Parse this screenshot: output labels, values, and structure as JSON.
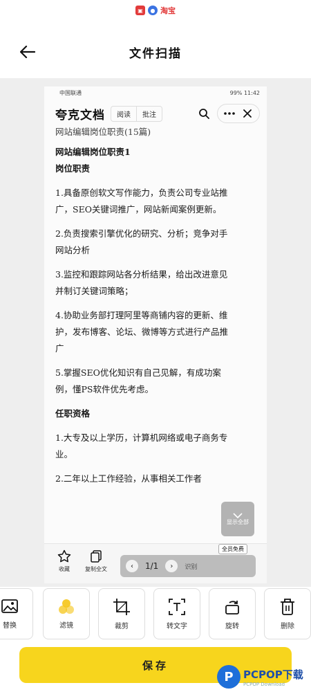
{
  "status_strip": {
    "badge_text": "淘宝"
  },
  "header": {
    "title": "文件扫描"
  },
  "document": {
    "phone_status": {
      "carrier": "中国联通",
      "battery": "99%",
      "time": "11:42"
    },
    "brand": "夸克文档",
    "tabs": [
      "阅读",
      "批注"
    ],
    "lines": [
      {
        "text": "网站编辑岗位职责(15篇)",
        "style": "cut"
      },
      {
        "text": "网站编辑岗位职责1",
        "style": "bold"
      },
      {
        "text": "岗位职责",
        "style": "bold"
      },
      {
        "text": "1.具备原创软文写作能力，负责公司专业站推",
        "style": "normal"
      },
      {
        "text": "广，SEO关键词推广，网站新闻案例更新。",
        "style": "normal"
      },
      {
        "text": "2.负责搜索引擎优化的研究、分析；竞争对手",
        "style": "normal"
      },
      {
        "text": "网站分析",
        "style": "normal"
      },
      {
        "text": "3.监控和跟踪网站各分析结果，给出改进意见",
        "style": "normal"
      },
      {
        "text": "并制订关键词策略；",
        "style": "normal"
      },
      {
        "text": "4.协助业务部打理阿里等商铺内容的更新、维",
        "style": "normal"
      },
      {
        "text": "护，发布博客、论坛、微博等方式进行产品推",
        "style": "normal"
      },
      {
        "text": "广",
        "style": "normal"
      },
      {
        "text": "5.掌握SEO优化知识有自己见解，有成功案",
        "style": "normal"
      },
      {
        "text": "例，懂PS软件优先考虑。",
        "style": "normal"
      },
      {
        "text": "任职资格",
        "style": "bold"
      },
      {
        "text": "1.大专及以上学历，计算机网络或电子商务专",
        "style": "normal"
      },
      {
        "text": "业。",
        "style": "normal"
      },
      {
        "text": "2.二年以上工作经验，从事相关工作者",
        "style": "normal"
      }
    ],
    "gap_after": [
      0,
      2,
      4,
      6,
      8,
      11,
      13,
      14,
      16
    ],
    "scroll_hint": "显示全部",
    "bottom": {
      "favorite_label": "收藏",
      "copy_label": "复制全文",
      "free_badge": "全员免费",
      "page_indicator": "1/1",
      "pager_hint": "识别"
    }
  },
  "toolbar": {
    "items": [
      {
        "name": "replace",
        "label": "替换",
        "icon": "image-icon"
      },
      {
        "name": "filter",
        "label": "滤镜",
        "icon": "filter-icon"
      },
      {
        "name": "crop",
        "label": "裁剪",
        "icon": "crop-icon"
      },
      {
        "name": "to-text",
        "label": "转文字",
        "icon": "text-scan-icon"
      },
      {
        "name": "rotate",
        "label": "旋转",
        "icon": "rotate-icon"
      },
      {
        "name": "delete",
        "label": "删除",
        "icon": "trash-icon"
      }
    ]
  },
  "save": {
    "label": "保存"
  },
  "watermark": {
    "logo": "P",
    "main": "PCPOP下载",
    "sub": "PCPOP Download"
  },
  "colors": {
    "accent": "#f7d51d",
    "filter_dot": "#f5c518",
    "preview_bg": "#eeeeee",
    "watermark_blue": "#1e6fd9"
  }
}
